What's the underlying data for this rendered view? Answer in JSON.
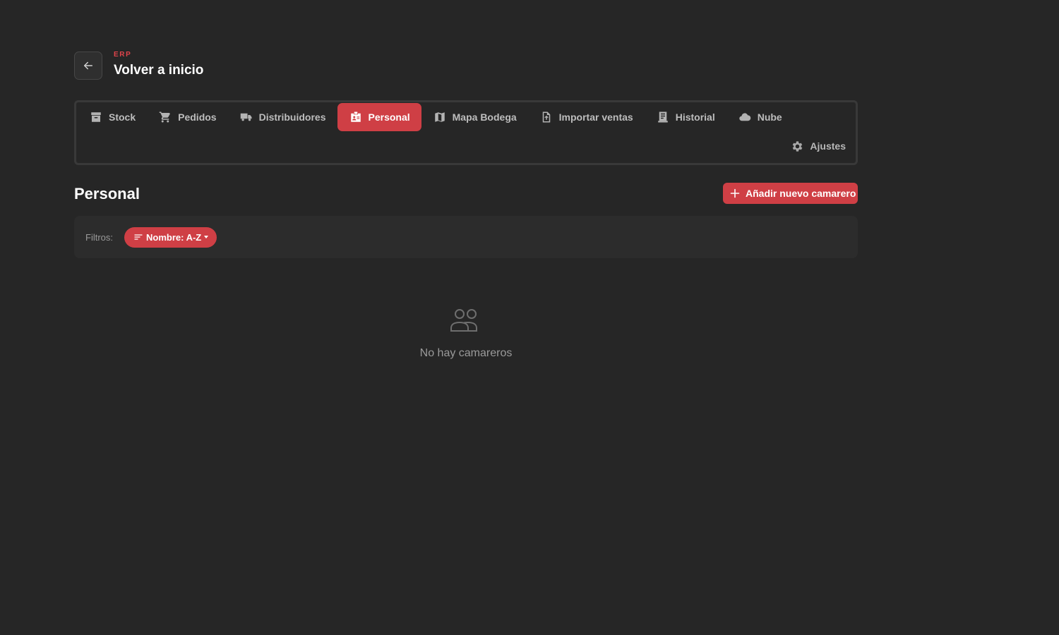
{
  "header": {
    "eyebrow": "ERP",
    "title": "Volver a inicio",
    "back_icon": "arrow-left-icon"
  },
  "nav": {
    "tabs": [
      {
        "label": "Stock",
        "icon": "archive-icon",
        "active": false
      },
      {
        "label": "Pedidos",
        "icon": "cart-icon",
        "active": false
      },
      {
        "label": "Distribuidores",
        "icon": "truck-icon",
        "active": false
      },
      {
        "label": "Personal",
        "icon": "id-badge-icon",
        "active": true
      },
      {
        "label": "Mapa Bodega",
        "icon": "map-icon",
        "active": false
      },
      {
        "label": "Importar ventas",
        "icon": "file-upload-icon",
        "active": false
      },
      {
        "label": "Historial",
        "icon": "receipt-icon",
        "active": false
      },
      {
        "label": "Nube",
        "icon": "cloud-icon",
        "active": false
      }
    ],
    "settings": {
      "label": "Ajustes",
      "icon": "gear-icon"
    }
  },
  "section": {
    "title": "Personal",
    "add_button": "Añadir nuevo camarero"
  },
  "filters": {
    "label": "Filtros:",
    "sort_chip": "Nombre: A-Z"
  },
  "empty_state": {
    "icon": "people-icon",
    "text": "No hay camareros"
  },
  "colors": {
    "background": "#262626",
    "accent": "#cf3f45",
    "panel": "#2c2c2c"
  }
}
